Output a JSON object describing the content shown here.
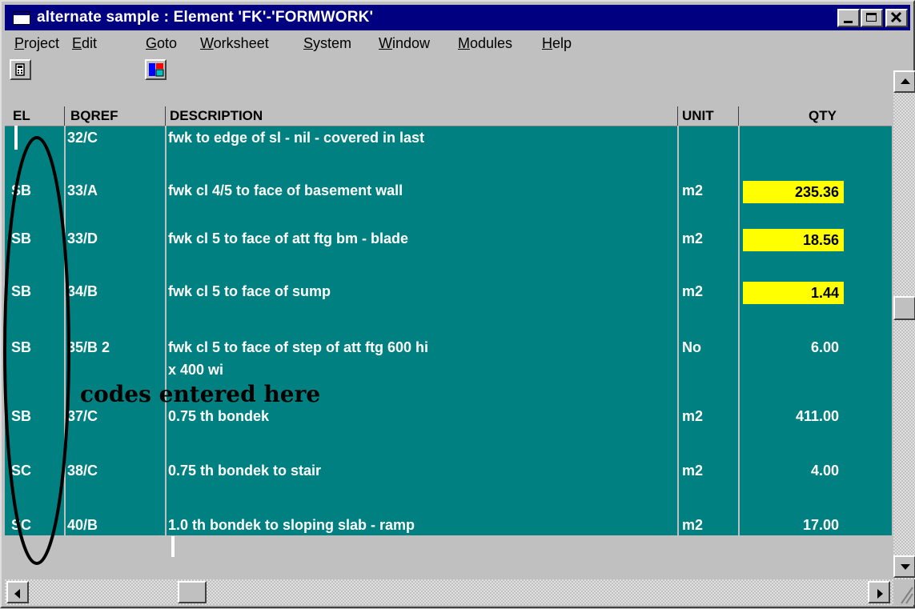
{
  "window": {
    "title": "alternate sample : Element 'FK'-'FORMWORK'",
    "min_btn": "_",
    "max_btn": "□",
    "close_btn": "✕"
  },
  "menu": [
    {
      "label": "Project",
      "ul": "P",
      "rest": "roject"
    },
    {
      "label": "Edit",
      "ul": "E",
      "rest": "dit"
    },
    {
      "label": "Goto",
      "ul": "G",
      "rest": "oto"
    },
    {
      "label": "Worksheet",
      "ul": "W",
      "rest": "orksheet"
    },
    {
      "label": "System",
      "ul": "S",
      "rest": "ystem"
    },
    {
      "label": "Window",
      "ul": "W",
      "rest": "indow"
    },
    {
      "label": "Modules",
      "ul": "M",
      "rest": "odules"
    },
    {
      "label": "Help",
      "ul": "H",
      "rest": "elp"
    }
  ],
  "columns": {
    "el": "EL",
    "bqref": "BQREF",
    "description": "DESCRIPTION",
    "unit": "UNIT",
    "qty": "QTY"
  },
  "rows": [
    {
      "el": "",
      "bqref": "32/C",
      "desc": "fwk to edge of sl - nil - covered in last",
      "desc2": "",
      "unit": "",
      "qty": "",
      "highlight": false
    },
    {
      "el": "SB",
      "bqref": "33/A",
      "desc": "fwk cl 4/5 to face of basement wall",
      "desc2": "",
      "unit": "m2",
      "qty": "235.36",
      "highlight": true
    },
    {
      "el": "SB",
      "bqref": "33/D",
      "desc": "fwk cl 5 to face of att ftg bm - blade",
      "desc2": "",
      "unit": "m2",
      "qty": "18.56",
      "highlight": true
    },
    {
      "el": "SB",
      "bqref": "34/B",
      "desc": "fwk cl 5 to face of sump",
      "desc2": "",
      "unit": "m2",
      "qty": "1.44",
      "highlight": true
    },
    {
      "el": "SB",
      "bqref": "35/B 2",
      "desc": "fwk cl 5 to face of step of att ftg 600 hi",
      "desc2": "x 400 wi",
      "unit": "No",
      "qty": "6.00",
      "highlight": false
    },
    {
      "el": "SB",
      "bqref": "37/C",
      "desc": "0.75 th bondek",
      "desc2": "",
      "unit": "m2",
      "qty": "411.00",
      "highlight": false
    },
    {
      "el": "SC",
      "bqref": "38/C",
      "desc": "0.75 th bondek to stair",
      "desc2": "",
      "unit": "m2",
      "qty": "4.00",
      "highlight": false
    },
    {
      "el": "SC",
      "bqref": "40/B",
      "desc": "1.0 th bondek to sloping slab - ramp",
      "desc2": "",
      "unit": "m2",
      "qty": "17.00",
      "highlight": false
    }
  ],
  "annotation": "codes entered here",
  "colors": {
    "grid_bg": "#008080",
    "title_bg": "#000080",
    "highlight": "#ffff00",
    "chrome": "#c0c0c0"
  },
  "icons": [
    "window-icon",
    "calculator-icon",
    "color-palette-icon"
  ]
}
